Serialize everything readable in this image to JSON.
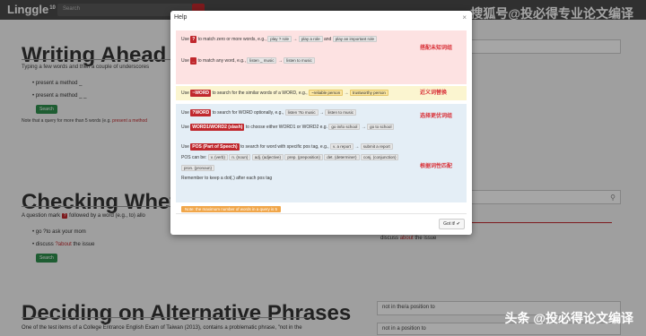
{
  "nav": {
    "logo": "Linggle",
    "logo_sup": "10",
    "search_placeholder": "Search"
  },
  "watermarks": {
    "top": "搜狐号@投必得专业论文编译",
    "bottom": "头条 @投必得论文编译"
  },
  "writing_ahead": {
    "title": "Writing Ahead",
    "desc": "Typing a few words and then a couple of underscores",
    "items": [
      "present a method _",
      "present a method _ _"
    ],
    "btn": "Search",
    "note_prefix": "Note that a query for more than 5 words (e.g.",
    "note_red": "present a method",
    "note_suffix": ""
  },
  "checking": {
    "title": "Checking Whether a Word Is Ne",
    "desc_a": "A question mark",
    "qmark": "?",
    "desc_b": "followed by a word (e.g., to) allo",
    "items": [
      "go ?to ask your mom"
    ],
    "item2_a": "discuss",
    "item2_red": "?about",
    "item2_b": "the issue",
    "btn": "Search"
  },
  "deciding": {
    "title": "Deciding on Alternative Phrases",
    "desc": "One of the test items of a College Entrance English Exam of Taiwan (2013), contains a problematic phrase, \"not in the"
  },
  "right": {
    "r1": "",
    "r2": "",
    "r2_text_a": "discuss",
    "r2_text_red": "about",
    "r2_text_b": "the issue",
    "r3": "not in the/a position to",
    "r3b": "not in a position to"
  },
  "modal": {
    "title": "Help",
    "close": "×",
    "rows": {
      "q_use": "Use",
      "q_tag": "?",
      "q_text": "to match zero or more words, e.g.,",
      "q_c1": "play ? role",
      "q_c2": "play a role",
      "q_and": "and",
      "q_c3": "play an important role",
      "u_use": "Use",
      "u_tag": "_",
      "u_text": "to match any word, e.g.,",
      "u_c1": "listen _ music",
      "u_c2": "listen to music",
      "s_use": "Use",
      "s_tag": "~WORD",
      "s_text": "to search for the similar words of a WORD, e.g.,",
      "s_c1": "~reliable person",
      "s_c2": "trustworthy person",
      "o_use": "Use",
      "o_tag": "?WORD",
      "o_text": "to search for WORD optionally,",
      "o_eg": "e.g.,",
      "o_c1": "listen ?to music",
      "o_c2": "listen to music",
      "e_use": "Use",
      "e_tag": "WORD1/WORD2 (slash)",
      "e_text": "to choose either WORD1 or WORD2 e.g.",
      "e_c1": "go in/to school",
      "e_c2": "go to school",
      "p_use": "Use",
      "p_tag": "POS (Part of Speech)",
      "p_text": "to search for word with specific pos tag, e.g.,",
      "p_c1": "v. a report",
      "p_c2": "submit a report",
      "pos_label": "POS can be:",
      "pos": [
        "v. (verb)",
        "n. (noun)",
        "adj. (adjective)",
        "prep. (preposition)",
        "det. (determiner)",
        "conj. (conjunction)",
        "pron. (pronoun)"
      ],
      "remember": "Remember to keep a dot(.) after each pos tag",
      "tip": "Note: the maximum number of words in a query is 5"
    },
    "annotations": {
      "a1": "搭配未知词组",
      "a2": "近义词替换",
      "a3": "选择更优词组",
      "a4": "根据词性匹配"
    },
    "gotit": "Got it! ✔"
  },
  "colors": {
    "accent": "#c0282d",
    "green": "#2f8f4e",
    "annotation": "#d9333a"
  }
}
